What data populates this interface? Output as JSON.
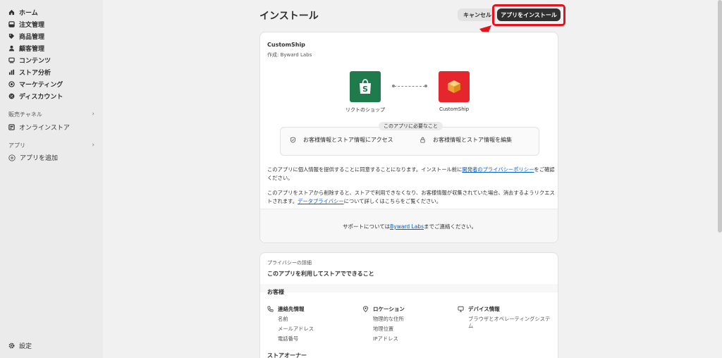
{
  "sidebar": {
    "items": [
      {
        "label": "ホーム",
        "icon": "home-icon"
      },
      {
        "label": "注文管理",
        "icon": "inbox-icon"
      },
      {
        "label": "商品管理",
        "icon": "tag-icon"
      },
      {
        "label": "顧客管理",
        "icon": "person-icon"
      },
      {
        "label": "コンテンツ",
        "icon": "content-icon"
      },
      {
        "label": "ストア分析",
        "icon": "bar-chart-icon"
      },
      {
        "label": "マーケティング",
        "icon": "target-icon"
      },
      {
        "label": "ディスカウント",
        "icon": "discount-icon"
      }
    ],
    "sales_channels_label": "販売チャネル",
    "online_store_label": "オンラインストア",
    "apps_label": "アプリ",
    "add_app_label": "アプリを追加",
    "settings_label": "設定"
  },
  "header": {
    "title": "インストール",
    "cancel_label": "キャンセル",
    "install_label": "アプリをインストール"
  },
  "app_card": {
    "name": "CustomShip",
    "author": "作成: Byward Labs",
    "shop_label": "リクトのショップ",
    "app_label": "CustomShip",
    "needs_title": "このアプリに必要なこと",
    "perm_access": "お客様情報とストア情報にアクセス",
    "perm_edit": "お客様情報とストア情報を編集",
    "consent_text_1": "このアプリに個人情報を提供することに同意することになります。インストール前に",
    "consent_link": "開発者のプライバシーポリシー",
    "consent_text_2": "をご確認ください。",
    "removal_text_1": "このアプリをストアから削除すると、ストアで利用できなくなり、お客様情報が収集されていた場合、消去するようリクエストされます。",
    "removal_link": "データプライバシー",
    "removal_text_2": "について詳しくはこちらをご覧ください。",
    "support_text_1": "サポートについては",
    "support_link": "Byward Labs",
    "support_text_2": "までご連絡ください。"
  },
  "privacy_card": {
    "subtitle": "プライバシーの詳細",
    "title": "このアプリを利用してストアでできること",
    "section_customers": "お客様",
    "col_contact": {
      "head": "連絡先情報",
      "items": [
        "名前",
        "メールアドレス",
        "電話番号"
      ]
    },
    "col_location": {
      "head": "ロケーション",
      "items": [
        "物理的な住所",
        "地理位置",
        "IPアドレス"
      ]
    },
    "col_device": {
      "head": "デバイス情報",
      "items": [
        "ブラウザとオペレーティングシステム"
      ]
    },
    "section_owner": "ストアオーナー"
  },
  "colors": {
    "accent": "#303030",
    "highlight": "#e8121c",
    "shopify_green": "#1f7a4c",
    "app_red": "#e5272d",
    "link": "#005bd3"
  }
}
